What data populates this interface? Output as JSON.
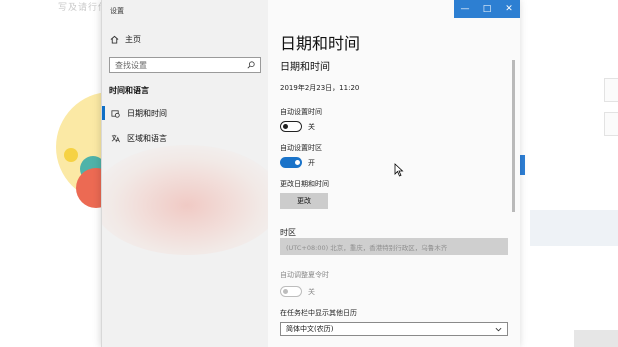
{
  "background": {
    "title": "写及请行传"
  },
  "window": {
    "app_title": "设置",
    "controls": {
      "minimize": "—",
      "maximize": "□",
      "close": "✕"
    }
  },
  "sidebar": {
    "home_label": "主页",
    "search_placeholder": "查找设置",
    "section_label": "时间和语言",
    "items": [
      {
        "label": "日期和时间",
        "icon": "calendar-clock-icon",
        "active": true
      },
      {
        "label": "区域和语言",
        "icon": "language-icon",
        "active": false
      }
    ]
  },
  "main": {
    "page_title": "日期和时间",
    "section_title": "日期和时间",
    "current_datetime": "2019年2月23日，11:20",
    "auto_time": {
      "label": "自动设置时间",
      "state_text": "关",
      "on": false
    },
    "auto_timezone": {
      "label": "自动设置时区",
      "state_text": "开",
      "on": true
    },
    "change_datetime": {
      "label": "更改日期和时间",
      "button": "更改"
    },
    "timezone": {
      "heading": "时区",
      "value": "(UTC+08:00) 北京，重庆，香港特别行政区，乌鲁木齐"
    },
    "dst": {
      "label": "自动调整夏令时",
      "state_text": "关",
      "on": false,
      "disabled": true
    },
    "calendar": {
      "label": "在任务栏中显示其他日历",
      "value": "简体中文(农历)"
    }
  },
  "colors": {
    "accent": "#1a73c9",
    "sidebar_bg": "#f1f1f1",
    "main_bg": "#fafafa"
  }
}
